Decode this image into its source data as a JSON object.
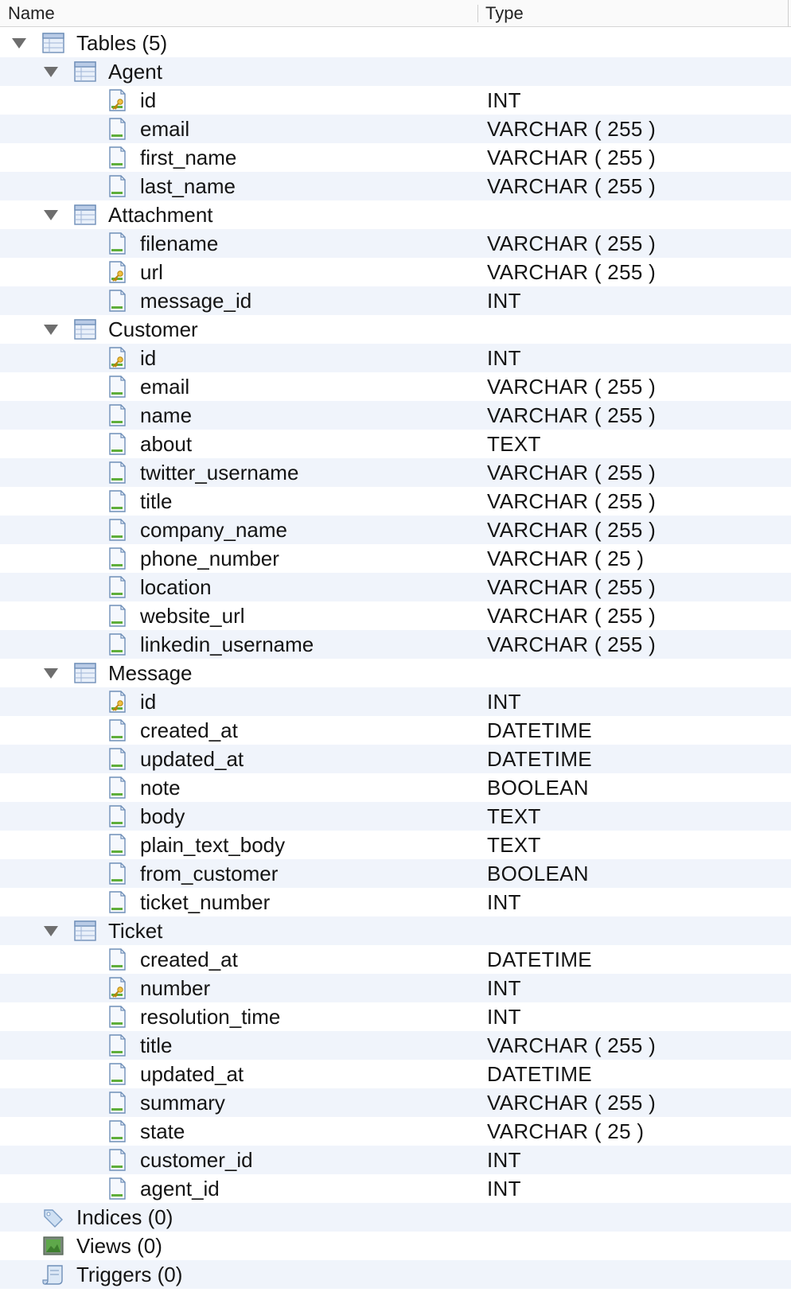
{
  "columns": {
    "name": "Name",
    "type": "Type"
  },
  "root": {
    "label": "Tables (5)",
    "icon": "table-icon"
  },
  "tables": [
    {
      "name": "Agent",
      "fields": [
        {
          "name": "id",
          "type": "INT",
          "key": true
        },
        {
          "name": "email",
          "type": "VARCHAR ( 255 )",
          "key": false
        },
        {
          "name": "first_name",
          "type": "VARCHAR ( 255 )",
          "key": false
        },
        {
          "name": "last_name",
          "type": "VARCHAR ( 255 )",
          "key": false
        }
      ]
    },
    {
      "name": "Attachment",
      "fields": [
        {
          "name": "filename",
          "type": "VARCHAR ( 255 )",
          "key": false
        },
        {
          "name": "url",
          "type": "VARCHAR ( 255 )",
          "key": true
        },
        {
          "name": "message_id",
          "type": "INT",
          "key": false
        }
      ]
    },
    {
      "name": "Customer",
      "fields": [
        {
          "name": "id",
          "type": "INT",
          "key": true
        },
        {
          "name": "email",
          "type": "VARCHAR ( 255 )",
          "key": false
        },
        {
          "name": "name",
          "type": "VARCHAR ( 255 )",
          "key": false
        },
        {
          "name": "about",
          "type": "TEXT",
          "key": false
        },
        {
          "name": "twitter_username",
          "type": "VARCHAR ( 255 )",
          "key": false
        },
        {
          "name": "title",
          "type": "VARCHAR ( 255 )",
          "key": false
        },
        {
          "name": "company_name",
          "type": "VARCHAR ( 255 )",
          "key": false
        },
        {
          "name": "phone_number",
          "type": "VARCHAR ( 25 )",
          "key": false
        },
        {
          "name": "location",
          "type": "VARCHAR ( 255 )",
          "key": false
        },
        {
          "name": "website_url",
          "type": "VARCHAR ( 255 )",
          "key": false
        },
        {
          "name": "linkedin_username",
          "type": "VARCHAR ( 255 )",
          "key": false
        }
      ]
    },
    {
      "name": "Message",
      "fields": [
        {
          "name": "id",
          "type": "INT",
          "key": true
        },
        {
          "name": "created_at",
          "type": "DATETIME",
          "key": false
        },
        {
          "name": "updated_at",
          "type": "DATETIME",
          "key": false
        },
        {
          "name": "note",
          "type": "BOOLEAN",
          "key": false
        },
        {
          "name": "body",
          "type": "TEXT",
          "key": false
        },
        {
          "name": "plain_text_body",
          "type": "TEXT",
          "key": false
        },
        {
          "name": "from_customer",
          "type": "BOOLEAN",
          "key": false
        },
        {
          "name": "ticket_number",
          "type": "INT",
          "key": false
        }
      ]
    },
    {
      "name": "Ticket",
      "fields": [
        {
          "name": "created_at",
          "type": "DATETIME",
          "key": false
        },
        {
          "name": "number",
          "type": "INT",
          "key": true
        },
        {
          "name": "resolution_time",
          "type": "INT",
          "key": false
        },
        {
          "name": "title",
          "type": "VARCHAR ( 255 )",
          "key": false
        },
        {
          "name": "updated_at",
          "type": "DATETIME",
          "key": false
        },
        {
          "name": "summary",
          "type": "VARCHAR ( 255 )",
          "key": false
        },
        {
          "name": "state",
          "type": "VARCHAR ( 25 )",
          "key": false
        },
        {
          "name": "customer_id",
          "type": "INT",
          "key": false
        },
        {
          "name": "agent_id",
          "type": "INT",
          "key": false
        }
      ]
    }
  ],
  "other_nodes": [
    {
      "label": "Indices (0)",
      "icon": "index-tag-icon"
    },
    {
      "label": "Views (0)",
      "icon": "view-icon"
    },
    {
      "label": "Triggers (0)",
      "icon": "trigger-scroll-icon"
    }
  ],
  "colors": {
    "row_alt": "#f0f4fb",
    "header_bg": "#fafafa",
    "disclosure": "#6e6e6e"
  }
}
